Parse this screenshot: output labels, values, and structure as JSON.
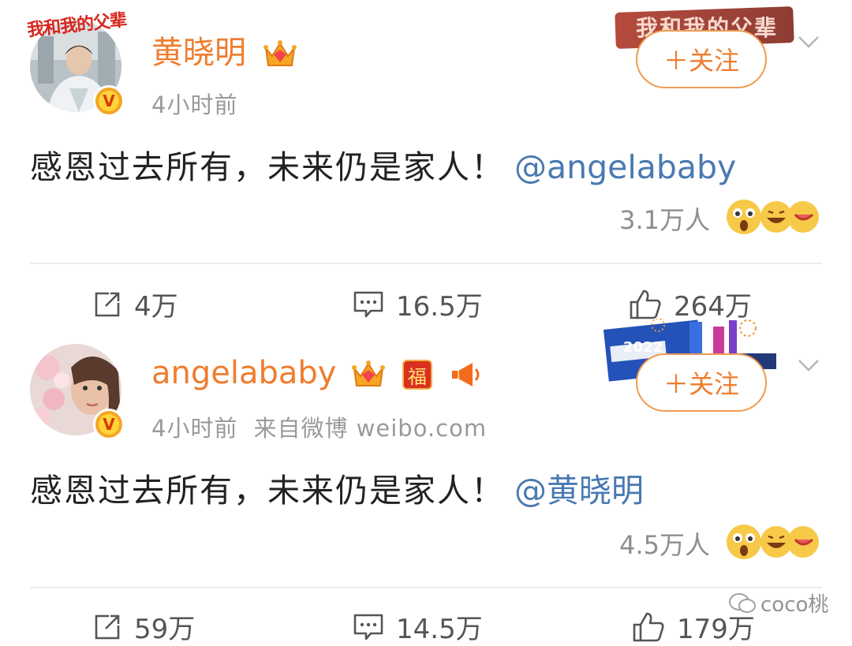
{
  "post1": {
    "avatar_tag": "我和我的父辈",
    "author": "黄晓明",
    "time": "4小时前",
    "follow_label": "＋关注",
    "text": "感恩过去所有，未来仍是家人！",
    "mention": "@angelababy",
    "reaction_count": "3.1万人",
    "banner_text": "我和我的父辈",
    "actions": {
      "repost": "4万",
      "comment": "16.5万",
      "like": "264万"
    }
  },
  "post2": {
    "author": "angelababy",
    "time": "4小时前",
    "source": "来自微博 weibo.com",
    "follow_label": "＋关注",
    "text": "感恩过去所有，未来仍是家人！",
    "mention": "@黄晓明",
    "reaction_count": "4.5万人",
    "fu_badge": "福",
    "banner_text": "2022",
    "actions": {
      "repost": "59万",
      "comment": "14.5万",
      "like": "179万"
    }
  },
  "watermark": "coco桃",
  "colors": {
    "name": "#ef7d2f",
    "mention": "#4a79b1",
    "meta": "#9a9a9a",
    "divider": "#ececec"
  }
}
